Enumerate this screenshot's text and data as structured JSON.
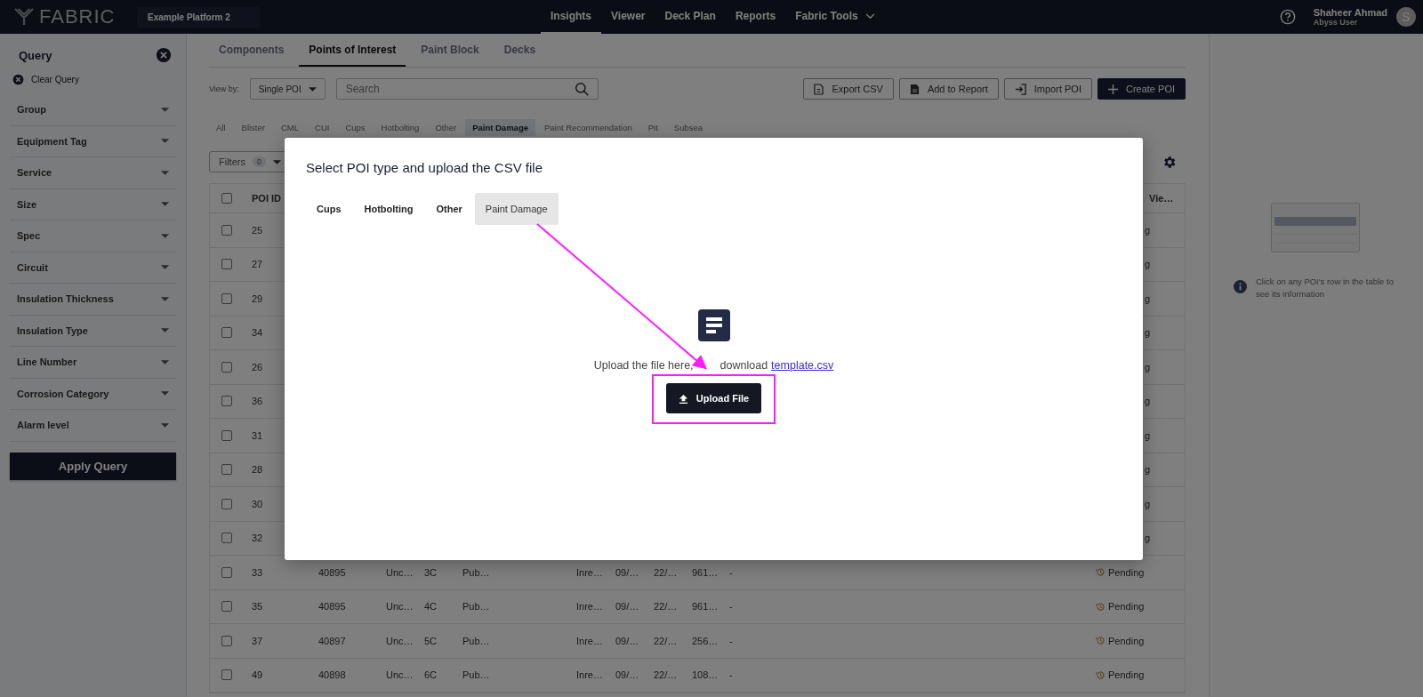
{
  "topbar": {
    "logo": "FABRIC",
    "platform": "Example Platform 2",
    "nav": [
      {
        "label": "Insights",
        "selected": true,
        "kind": "link"
      },
      {
        "label": "Viewer",
        "selected": false,
        "kind": "link"
      },
      {
        "label": "Deck Plan",
        "selected": false,
        "kind": "link"
      },
      {
        "label": "Reports",
        "selected": false,
        "kind": "link"
      },
      {
        "label": "Fabric Tools",
        "selected": false,
        "kind": "menu"
      }
    ],
    "user": {
      "name": "Shaheer Ahmad",
      "role": "Abyss User",
      "initial": "S"
    }
  },
  "sidebar": {
    "title": "Query",
    "clear_label": "Clear Query",
    "filters": [
      "Group",
      "Equipment Tag",
      "Service",
      "Size",
      "Spec",
      "Circuit",
      "Insulation Thickness",
      "Insulation Type",
      "Line Number",
      "Corrosion Category",
      "Alarm level"
    ],
    "apply_label": "Apply Query"
  },
  "main": {
    "tabs": [
      {
        "label": "Components",
        "selected": false
      },
      {
        "label": "Points of Interest",
        "selected": true
      },
      {
        "label": "Paint Block",
        "selected": false
      },
      {
        "label": "Decks",
        "selected": false
      }
    ],
    "view_by_label": "View by:",
    "view_by_value": "Single POI",
    "search_placeholder": "Search",
    "actions": [
      {
        "label": "Export CSV",
        "kind": "export"
      },
      {
        "label": "Add to Report",
        "kind": "report"
      },
      {
        "label": "Import POI",
        "kind": "import"
      },
      {
        "label": "Create POI",
        "kind": "create"
      }
    ],
    "type_chips": [
      {
        "label": "All",
        "selected": false
      },
      {
        "label": "Blister",
        "selected": false
      },
      {
        "label": "CML",
        "selected": false
      },
      {
        "label": "CUI",
        "selected": false
      },
      {
        "label": "Cups",
        "selected": false
      },
      {
        "label": "Hotbolting",
        "selected": false
      },
      {
        "label": "Other",
        "selected": false
      },
      {
        "label": "Paint Damage",
        "selected": true
      },
      {
        "label": "Paint Recommendation",
        "selected": false
      },
      {
        "label": "Pit",
        "selected": false
      },
      {
        "label": "Subsea",
        "selected": false
      }
    ],
    "filters_label": "Filters",
    "filters_count": "0",
    "table": {
      "header_checked": false,
      "columns": [
        "POI ID",
        "Vie…"
      ],
      "rows": [
        {
          "poi_id": "25",
          "checked": false,
          "cells": [],
          "status": "g",
          "kind": "covered"
        },
        {
          "poi_id": "27",
          "checked": false,
          "cells": [],
          "status": "g",
          "kind": "covered"
        },
        {
          "poi_id": "29",
          "checked": false,
          "cells": [],
          "status": "g",
          "kind": "covered"
        },
        {
          "poi_id": "34",
          "checked": false,
          "cells": [],
          "status": "g",
          "kind": "covered"
        },
        {
          "poi_id": "26",
          "checked": false,
          "cells": [],
          "status": "g",
          "kind": "covered"
        },
        {
          "poi_id": "36",
          "checked": false,
          "cells": [],
          "status": "g",
          "kind": "covered"
        },
        {
          "poi_id": "31",
          "checked": false,
          "cells": [],
          "status": "g",
          "kind": "covered"
        },
        {
          "poi_id": "28",
          "checked": false,
          "cells": [],
          "status": "g",
          "kind": "covered"
        },
        {
          "poi_id": "30",
          "checked": false,
          "cells": [],
          "status": "g",
          "kind": "covered"
        },
        {
          "poi_id": "32",
          "checked": false,
          "cells": [],
          "status": "g",
          "kind": "covered"
        },
        {
          "poi_id": "33",
          "checked": false,
          "cells": [
            "40895",
            "Unc…",
            "3C",
            "Pub…",
            "Inre…",
            "09/…",
            "22/…",
            "961…",
            "-"
          ],
          "status": "Pending",
          "kind": "full"
        },
        {
          "poi_id": "35",
          "checked": false,
          "cells": [
            "40895",
            "Unc…",
            "4C",
            "Pub…",
            "Inre…",
            "09/…",
            "22/…",
            "961…",
            "-"
          ],
          "status": "Pending",
          "kind": "full"
        },
        {
          "poi_id": "37",
          "checked": false,
          "cells": [
            "40897",
            "Unc…",
            "5C",
            "Pub…",
            "Inre…",
            "09/…",
            "22/…",
            "256…",
            "-"
          ],
          "status": "Pending",
          "kind": "full"
        },
        {
          "poi_id": "49",
          "checked": false,
          "cells": [
            "40898",
            "Unc…",
            "6C",
            "Pub…",
            "Inre…",
            "09/…",
            "22/…",
            "108…",
            "-"
          ],
          "status": "Pending",
          "kind": "full"
        }
      ]
    }
  },
  "side_panel": {
    "hint": "Click on any POI's row in the table to see its information"
  },
  "modal": {
    "title": "Select POI type and upload the CSV file",
    "tabs": [
      {
        "label": "Cups",
        "selected": false
      },
      {
        "label": "Hotbolting",
        "selected": false
      },
      {
        "label": "Other",
        "selected": false
      },
      {
        "label": "Paint Damage",
        "selected": true
      }
    ],
    "hint_before": "Upload the file here,",
    "hint_after": "download",
    "template_link": "template.csv",
    "upload_label": "Upload File"
  }
}
